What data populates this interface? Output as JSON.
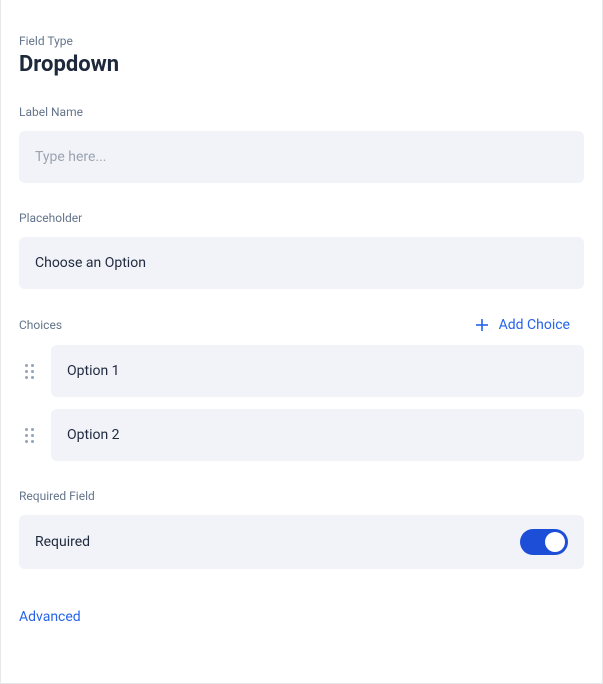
{
  "header": {
    "field_type_label": "Field Type",
    "field_type_value": "Dropdown"
  },
  "label_name": {
    "label": "Label Name",
    "placeholder": "Type here...",
    "value": ""
  },
  "placeholder_field": {
    "label": "Placeholder",
    "value": "Choose an Option"
  },
  "choices": {
    "label": "Choices",
    "add_button": "Add Choice",
    "items": [
      {
        "value": "Option 1"
      },
      {
        "value": "Option 2"
      }
    ]
  },
  "required_field": {
    "label": "Required Field",
    "row_label": "Required",
    "enabled": true
  },
  "advanced": {
    "label": "Advanced"
  }
}
